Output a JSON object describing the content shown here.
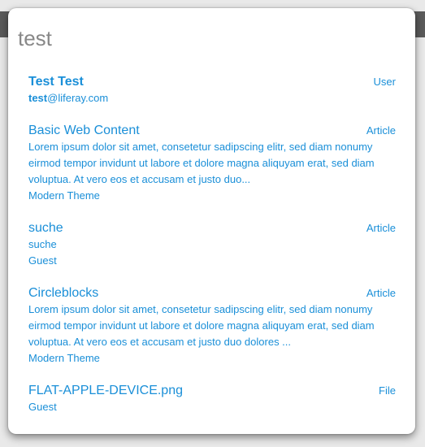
{
  "search": {
    "value": "test"
  },
  "results": [
    {
      "title": "Test Test",
      "type": "User",
      "email_highlight": "test",
      "email_rest": "@liferay.com"
    },
    {
      "title": "Basic Web Content",
      "type": "Article",
      "snippet": "Lorem ipsum dolor sit amet, consetetur sadipscing elitr, sed diam nonumy eirmod tempor invidunt ut labore et dolore magna aliquyam erat, sed diam voluptua. At vero eos et accusam et justo duo...",
      "meta": "Modern Theme"
    },
    {
      "title": "suche",
      "type": "Article",
      "snippet": "suche",
      "meta": "Guest"
    },
    {
      "title": "Circleblocks",
      "type": "Article",
      "snippet": "Lorem ipsum dolor sit amet, consetetur sadipscing elitr, sed diam nonumy eirmod tempor invidunt ut labore et dolore magna aliquyam erat, sed diam voluptua. At vero eos et accusam et justo duo dolores ...",
      "meta": "Modern Theme"
    },
    {
      "title": "FLAT-APPLE-DEVICE.png",
      "type": "File",
      "meta": "Guest"
    }
  ],
  "colors": {
    "link": "#1a8fd8",
    "input_text": "#888888",
    "header_bar": "#5a5a5a"
  }
}
